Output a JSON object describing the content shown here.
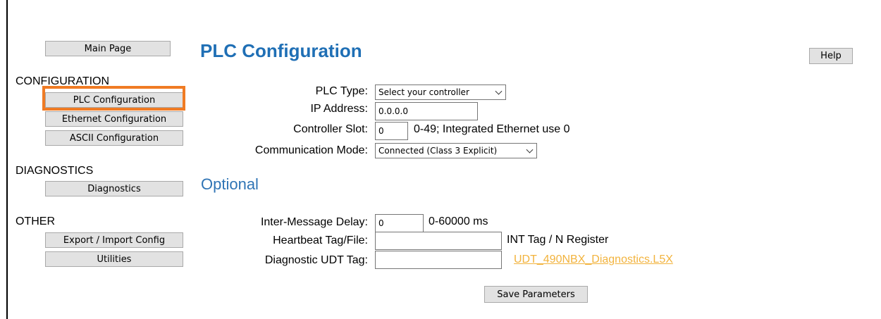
{
  "nav": {
    "main_page": "Main Page",
    "configuration_label": "CONFIGURATION",
    "plc_configuration": "PLC Configuration",
    "ethernet_configuration": "Ethernet Configuration",
    "ascii_configuration": "ASCII Configuration",
    "diagnostics_label": "DIAGNOSTICS",
    "diagnostics": "Diagnostics",
    "other_label": "OTHER",
    "export_import_config": "Export / Import Config",
    "utilities": "Utilities"
  },
  "header": {
    "title": "PLC Configuration",
    "help": "Help"
  },
  "form": {
    "plc_type_label": "PLC Type:",
    "plc_type_value": "Select your controller",
    "ip_address_label": "IP Address:",
    "ip_address_value": "0.0.0.0",
    "controller_slot_label": "Controller Slot:",
    "controller_slot_value": "0",
    "controller_slot_hint": "0-49; Integrated Ethernet use 0",
    "communication_mode_label": "Communication Mode:",
    "communication_mode_value": "Connected (Class 3 Explicit)"
  },
  "optional": {
    "title": "Optional",
    "inter_message_delay_label": "Inter-Message Delay:",
    "inter_message_delay_value": "0",
    "inter_message_delay_hint": "0-60000 ms",
    "heartbeat_label": "Heartbeat Tag/File:",
    "heartbeat_value": "",
    "heartbeat_hint": "INT Tag / N Register",
    "diagnostic_udt_label": "Diagnostic UDT Tag:",
    "diagnostic_udt_value": "",
    "diagnostic_udt_link": "UDT_490NBX_Diagnostics.L5X"
  },
  "actions": {
    "save": "Save Parameters"
  },
  "colors": {
    "title": "#1f6fb5",
    "highlight": "#f07b24",
    "link": "#f2b33d"
  }
}
